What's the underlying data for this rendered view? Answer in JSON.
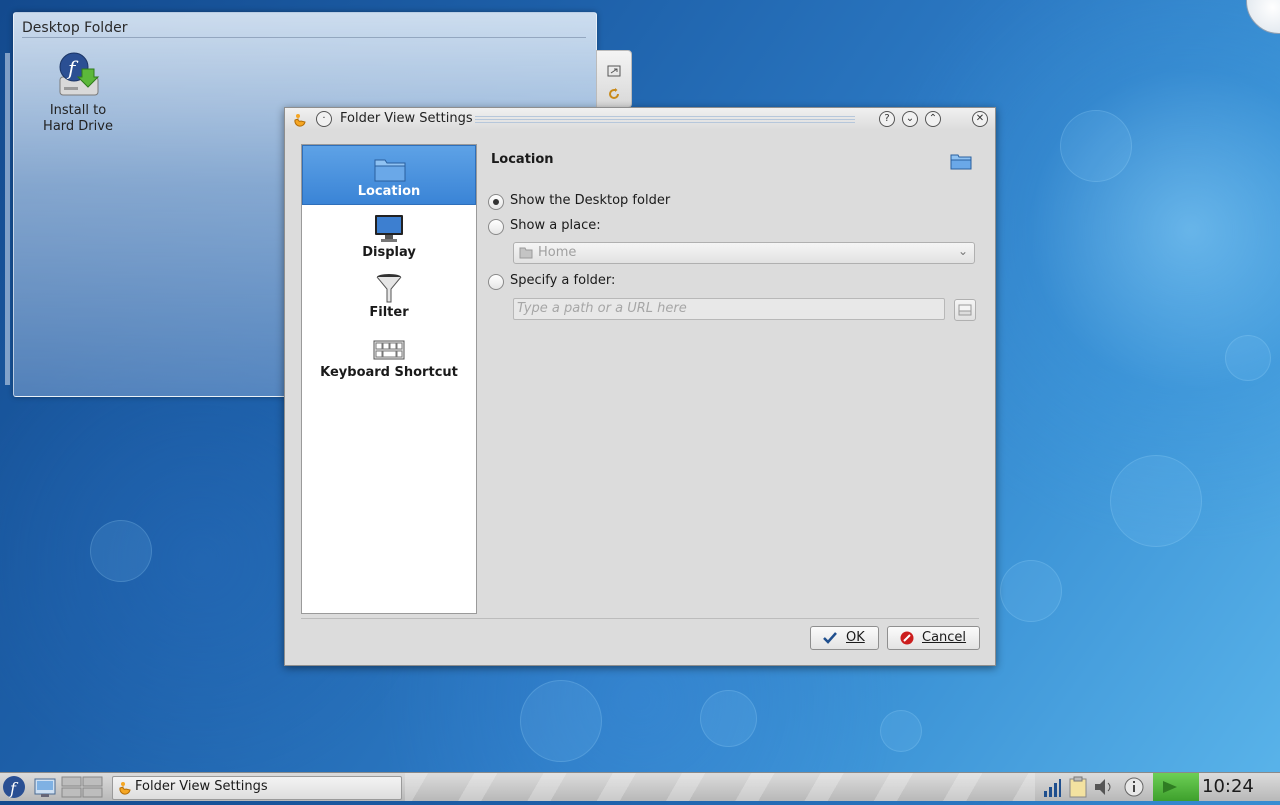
{
  "desktop": {
    "folder_title": "Desktop Folder",
    "icon_label_line1": "Install to",
    "icon_label_line2": "Hard Drive"
  },
  "dialog": {
    "title": "Folder View Settings",
    "sidebar": [
      {
        "label": "Location",
        "icon": "folder-icon",
        "selected": true
      },
      {
        "label": "Display",
        "icon": "monitor-icon",
        "selected": false
      },
      {
        "label": "Filter",
        "icon": "funnel-icon",
        "selected": false
      },
      {
        "label": "Keyboard Shortcut",
        "icon": "keyboard-icon",
        "selected": false
      }
    ],
    "section_title": "Location",
    "options": {
      "desktop_folder": "Show the Desktop folder",
      "place": "Show a place:",
      "folder": "Specify a folder:"
    },
    "selected_option": "desktop_folder",
    "place_value": "Home",
    "folder_placeholder": "Type a path or a URL here",
    "ok_label": "OK",
    "cancel_label": "Cancel"
  },
  "taskbar": {
    "task_title": "Folder View Settings",
    "clock": "10:24"
  },
  "colors": {
    "selection": "#3a84d6",
    "notification_green": "#4fb43a",
    "cancel_red": "#cc1e1e"
  }
}
